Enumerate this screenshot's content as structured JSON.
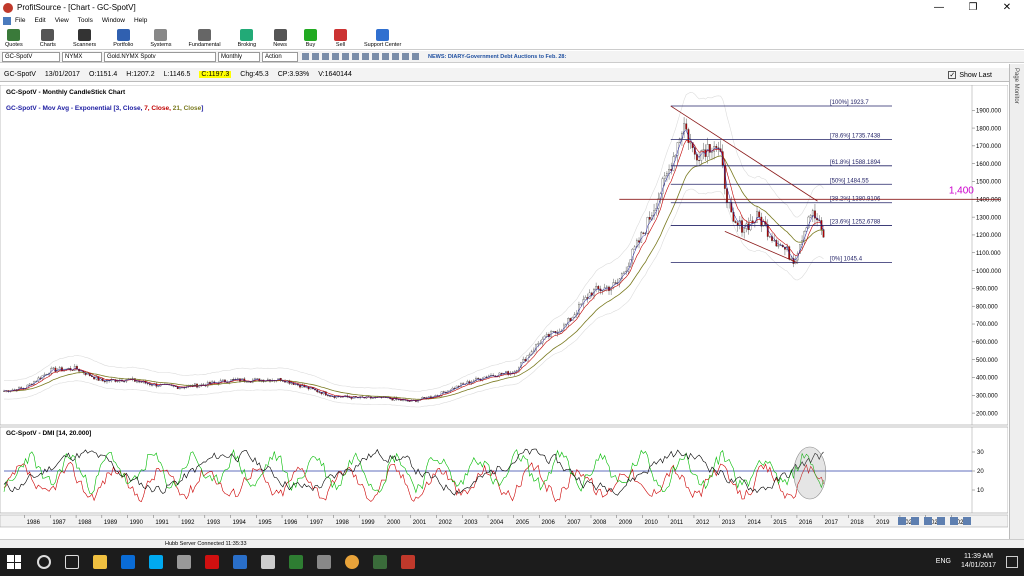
{
  "window": {
    "title": "ProfitSource - [Chart - GC-SpotV]"
  },
  "menu": [
    "File",
    "Edit",
    "View",
    "Tools",
    "Window",
    "Help"
  ],
  "toolbar": [
    {
      "label": "Quotes",
      "icon": "quotes-icon",
      "color": "#3a7a3a"
    },
    {
      "label": "Charts",
      "icon": "charts-icon",
      "color": "#555"
    },
    {
      "label": "Scanners",
      "icon": "scanners-icon",
      "color": "#333"
    },
    {
      "label": "Portfolio",
      "icon": "portfolio-icon",
      "color": "#3060b0"
    },
    {
      "label": "Systems",
      "icon": "systems-icon",
      "color": "#888"
    },
    {
      "label": "Fundamental",
      "icon": "fundamental-icon",
      "color": "#666"
    },
    {
      "label": "Broking",
      "icon": "broking-icon",
      "color": "#2a7"
    },
    {
      "label": "News",
      "icon": "news-icon",
      "color": "#555"
    },
    {
      "label": "Buy",
      "icon": "buy-icon",
      "color": "#2a2"
    },
    {
      "label": "Sell",
      "icon": "sell-icon",
      "color": "#c33"
    },
    {
      "label": "Support Center",
      "icon": "support-icon",
      "color": "#3070d0"
    }
  ],
  "symbar": {
    "symbol": "GC-SpotV",
    "exchange": "NYMX",
    "name": "Gold.NYMX Spotv",
    "period": "Monthly",
    "action": "Action",
    "news": "NEWS: DIARY-Government Debt Auctions to Feb. 28:"
  },
  "quote": {
    "symbol": "GC-SpotV",
    "date": "13/01/2017",
    "open": "O:1151.4",
    "high": "H:1207.2",
    "low": "L:1146.5",
    "close": "C:1197.3",
    "chg": "Chg:45.3",
    "cp": "CP:3.93%",
    "vol": "V:1640144",
    "show_last": "Show Last"
  },
  "side_panel": "Page Monitor",
  "status": "Hubb Server Connected 11:35:33",
  "taskbar": {
    "lang": "ENG",
    "time": "11:39 AM",
    "date": "14/01/2017"
  },
  "chart_data": {
    "type": "candlestick",
    "title": "GC-SpotV - Monthly CandleStick Chart",
    "indicator_title": {
      "prefix": "GC-SpotV - Mov Avg - Exponential [",
      "parts": [
        {
          "text": "3, Close,",
          "color": "#1a1aa0"
        },
        {
          "text": " 7, Close,",
          "color": "#c00000"
        },
        {
          "text": " 21, Close",
          "color": "#7a7a20"
        }
      ],
      "suffix": "]"
    },
    "years": [
      "1986",
      "1987",
      "1988",
      "1989",
      "1990",
      "1991",
      "1992",
      "1993",
      "1994",
      "1995",
      "1996",
      "1997",
      "1998",
      "1999",
      "2000",
      "2001",
      "2002",
      "2003",
      "2004",
      "2005",
      "2006",
      "2007",
      "2008",
      "2009",
      "2010",
      "2011",
      "2012",
      "2013",
      "2014",
      "2015",
      "2016",
      "2017",
      "2018",
      "2019",
      "2020",
      "2021",
      "2022"
    ],
    "x_start": 1985.2,
    "x_end": 2022.8,
    "ylim": [
      150,
      1980
    ],
    "y_ticks": [
      200,
      300,
      400,
      500,
      600,
      700,
      800,
      900,
      1000,
      1100,
      1200,
      1300,
      1400,
      1500,
      1600,
      1700,
      1800,
      1900
    ],
    "yearly_price": [
      [
        1985.0,
        320
      ],
      [
        1986.0,
        340
      ],
      [
        1987.0,
        440
      ],
      [
        1988.0,
        450
      ],
      [
        1989.0,
        380
      ],
      [
        1990.0,
        390
      ],
      [
        1991.0,
        360
      ],
      [
        1992.0,
        345
      ],
      [
        1993.0,
        360
      ],
      [
        1994.0,
        385
      ],
      [
        1995.0,
        385
      ],
      [
        1996.0,
        390
      ],
      [
        1997.0,
        340
      ],
      [
        1998.0,
        295
      ],
      [
        1999.0,
        285
      ],
      [
        2000.0,
        285
      ],
      [
        2001.0,
        265
      ],
      [
        2002.0,
        300
      ],
      [
        2003.0,
        360
      ],
      [
        2004.0,
        410
      ],
      [
        2005.0,
        430
      ],
      [
        2006.0,
        600
      ],
      [
        2007.0,
        690
      ],
      [
        2008.0,
        880
      ],
      [
        2009.0,
        920
      ],
      [
        2010.0,
        1200
      ],
      [
        2011.0,
        1550
      ],
      [
        2011.6,
        1830
      ],
      [
        2012.0,
        1650
      ],
      [
        2012.8,
        1720
      ],
      [
        2013.0,
        1650
      ],
      [
        2013.5,
        1250
      ],
      [
        2014.0,
        1250
      ],
      [
        2014.5,
        1300
      ],
      [
        2015.0,
        1200
      ],
      [
        2015.9,
        1060
      ],
      [
        2016.5,
        1330
      ],
      [
        2016.8,
        1280
      ],
      [
        2017.0,
        1197
      ]
    ],
    "fib_levels": [
      {
        "label": "[100%] 1923.7",
        "value": 1923.7
      },
      {
        "label": "[78.6%] 1735.7438",
        "value": 1735.7438
      },
      {
        "label": "[61.8%] 1588.1894",
        "value": 1588.1894
      },
      {
        "label": "[50%] 1484.55",
        "value": 1484.55
      },
      {
        "label": "[38.2%] 1380.9106",
        "value": 1380.9106
      },
      {
        "label": "[23.6%] 1252.6788",
        "value": 1252.6788
      },
      {
        "label": "[0%] 1045.4",
        "value": 1045.4
      }
    ],
    "annotation": {
      "text": "1,400",
      "value": 1400,
      "color": "#cc00cc"
    },
    "dmi": {
      "title": "GC-SpotV - DMI [14, 20.000]",
      "ylim": [
        0,
        40
      ],
      "y_ticks": [
        10,
        20,
        30
      ],
      "threshold": 20,
      "colors": {
        "adx": "#000000",
        "plus_di": "#00bb00",
        "minus_di": "#cc0000"
      }
    },
    "colors": {
      "up": "#ffffff",
      "down": "#b00000",
      "ema3": "#1a1aa0",
      "ema7": "#c00000",
      "ema21": "#7a7a20",
      "fib": "#222266",
      "trend": "#8b1a1a"
    }
  }
}
